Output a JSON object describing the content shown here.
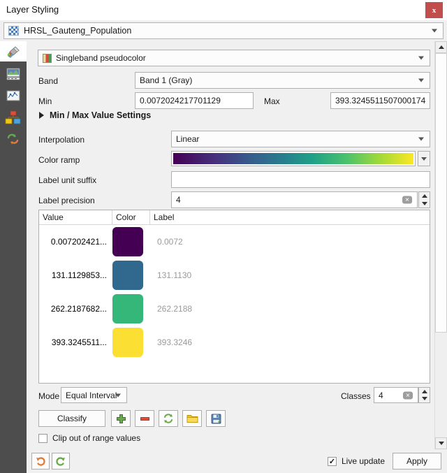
{
  "window": {
    "title": "Layer Styling",
    "close_label": "x"
  },
  "layer_selector": {
    "icon": "raster-layer-icon",
    "value": "HRSL_Gauteng_Population"
  },
  "sidebar": {
    "items": [
      {
        "name": "symbology-tab",
        "icon": "paintbrush-icon"
      },
      {
        "name": "transparency-tab",
        "icon": "raster-image-icon"
      },
      {
        "name": "histogram-tab",
        "icon": "histogram-icon"
      },
      {
        "name": "rendering-tab",
        "icon": "rendering-icon"
      },
      {
        "name": "history-tab",
        "icon": "undo-redo-icon"
      }
    ]
  },
  "symbology": {
    "render_type": "Singleband pseudocolor",
    "band_label": "Band",
    "band_value": "Band 1 (Gray)",
    "min_label": "Min",
    "min_value": "0.0072024217701129",
    "max_label": "Max",
    "max_value": "393.3245511507000174",
    "minmax_settings_label": "Min / Max Value Settings",
    "interpolation_label": "Interpolation",
    "interpolation_value": "Linear",
    "color_ramp_label": "Color ramp",
    "color_ramp_name": "Viridis",
    "label_unit_suffix_label": "Label unit suffix",
    "label_unit_suffix_value": "",
    "label_precision_label": "Label precision",
    "label_precision_value": "4"
  },
  "table": {
    "headers": [
      "Value",
      "Color",
      "Label"
    ],
    "rows": [
      {
        "value": "0.007202421...",
        "color": "#440154",
        "label": "0.0072"
      },
      {
        "value": "131.1129853...",
        "color": "#31688e",
        "label": "131.1130"
      },
      {
        "value": "262.2187682...",
        "color": "#35b779",
        "label": "262.2188"
      },
      {
        "value": "393.3245511...",
        "color": "#fbe033",
        "label": "393.3246"
      }
    ]
  },
  "classification": {
    "mode_label": "Mode",
    "mode_value": "Equal Interval",
    "classes_label": "Classes",
    "classes_value": "4",
    "classify_label": "Classify",
    "buttons": [
      {
        "name": "add-class-button",
        "icon": "plus-icon"
      },
      {
        "name": "remove-class-button",
        "icon": "minus-icon"
      },
      {
        "name": "sort-classes-button",
        "icon": "swap-arrows-icon"
      },
      {
        "name": "load-ramp-button",
        "icon": "folder-icon"
      },
      {
        "name": "save-ramp-button",
        "icon": "save-disk-icon"
      }
    ],
    "clip_label": "Clip out of range values",
    "clip_checked": false
  },
  "footer": {
    "undo_icon": "undo-arrow-icon",
    "redo_icon": "redo-arrow-icon",
    "live_update_label": "Live update",
    "live_update_checked": true,
    "live_update_mark": "✓",
    "apply_label": "Apply"
  },
  "colors": {
    "accent_close": "#c14d4d",
    "sidebar_bg": "#4d4d4d",
    "panel_bg": "#f0f0f0"
  }
}
